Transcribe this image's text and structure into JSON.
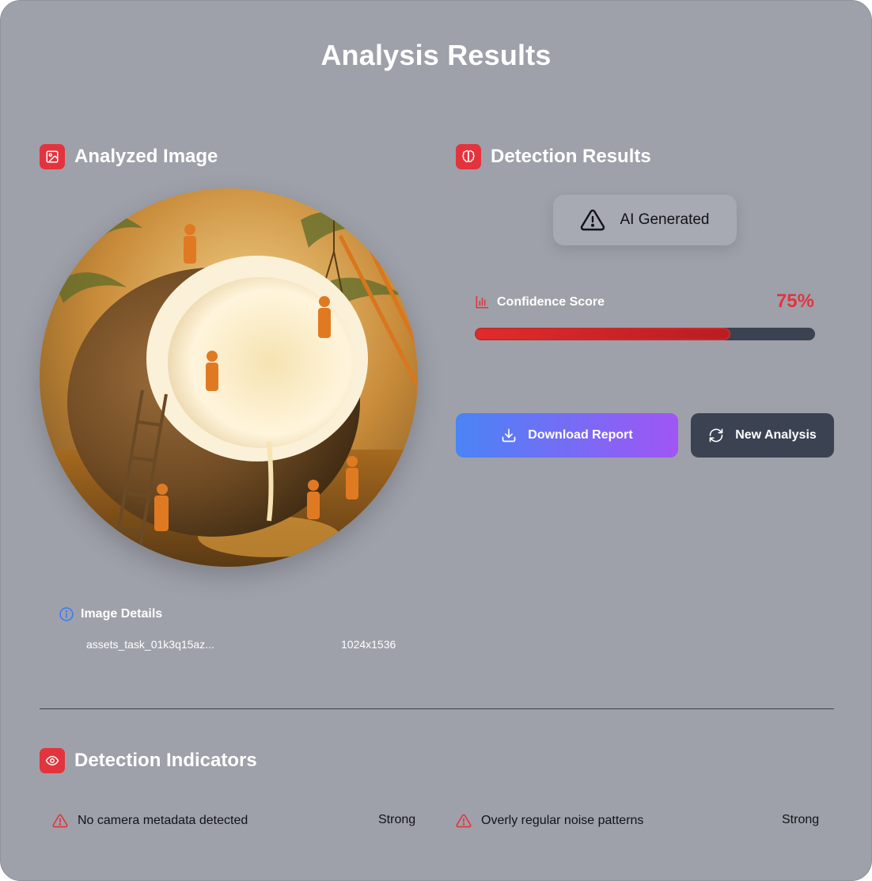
{
  "header": {
    "title": "Analysis Results",
    "subtitle": ""
  },
  "analyzed_image": {
    "section_title": "Analyzed Image",
    "section_icon": "image-icon",
    "image_description_icon": "coconut-workers-photo",
    "details_title": "Image Details",
    "details_icon": "info-icon",
    "file_name": "assets_task_01k3q15az...",
    "dimensions": "1024x1536"
  },
  "detection": {
    "section_title": "Detection Results",
    "section_icon": "brain-icon",
    "verdict_icon": "warning-triangle-icon",
    "verdict_label": "AI Generated",
    "confidence_label": "Confidence Score",
    "confidence_icon": "bar-chart-icon",
    "confidence_value": "75%",
    "confidence_fraction": 0.75,
    "confidence_color": "#e3343e"
  },
  "actions": {
    "download_label": "Download Report",
    "download_icon": "download-icon",
    "new_label": "New Analysis",
    "new_icon": "refresh-icon"
  },
  "indicators": {
    "section_title": "Detection Indicators",
    "section_icon": "eye-icon",
    "items": [
      {
        "label": "No camera metadata detected",
        "strength": "Strong",
        "icon": "warning-triangle-icon"
      },
      {
        "label": "Overly regular noise patterns",
        "strength": "Strong",
        "icon": "warning-triangle-icon"
      }
    ]
  },
  "colors": {
    "accent_red": "#e3343e",
    "card_bg": "#9ea1a9",
    "dark_button": "#3b4252",
    "gradient_start": "#4a84f5",
    "gradient_end": "#a055f4"
  }
}
